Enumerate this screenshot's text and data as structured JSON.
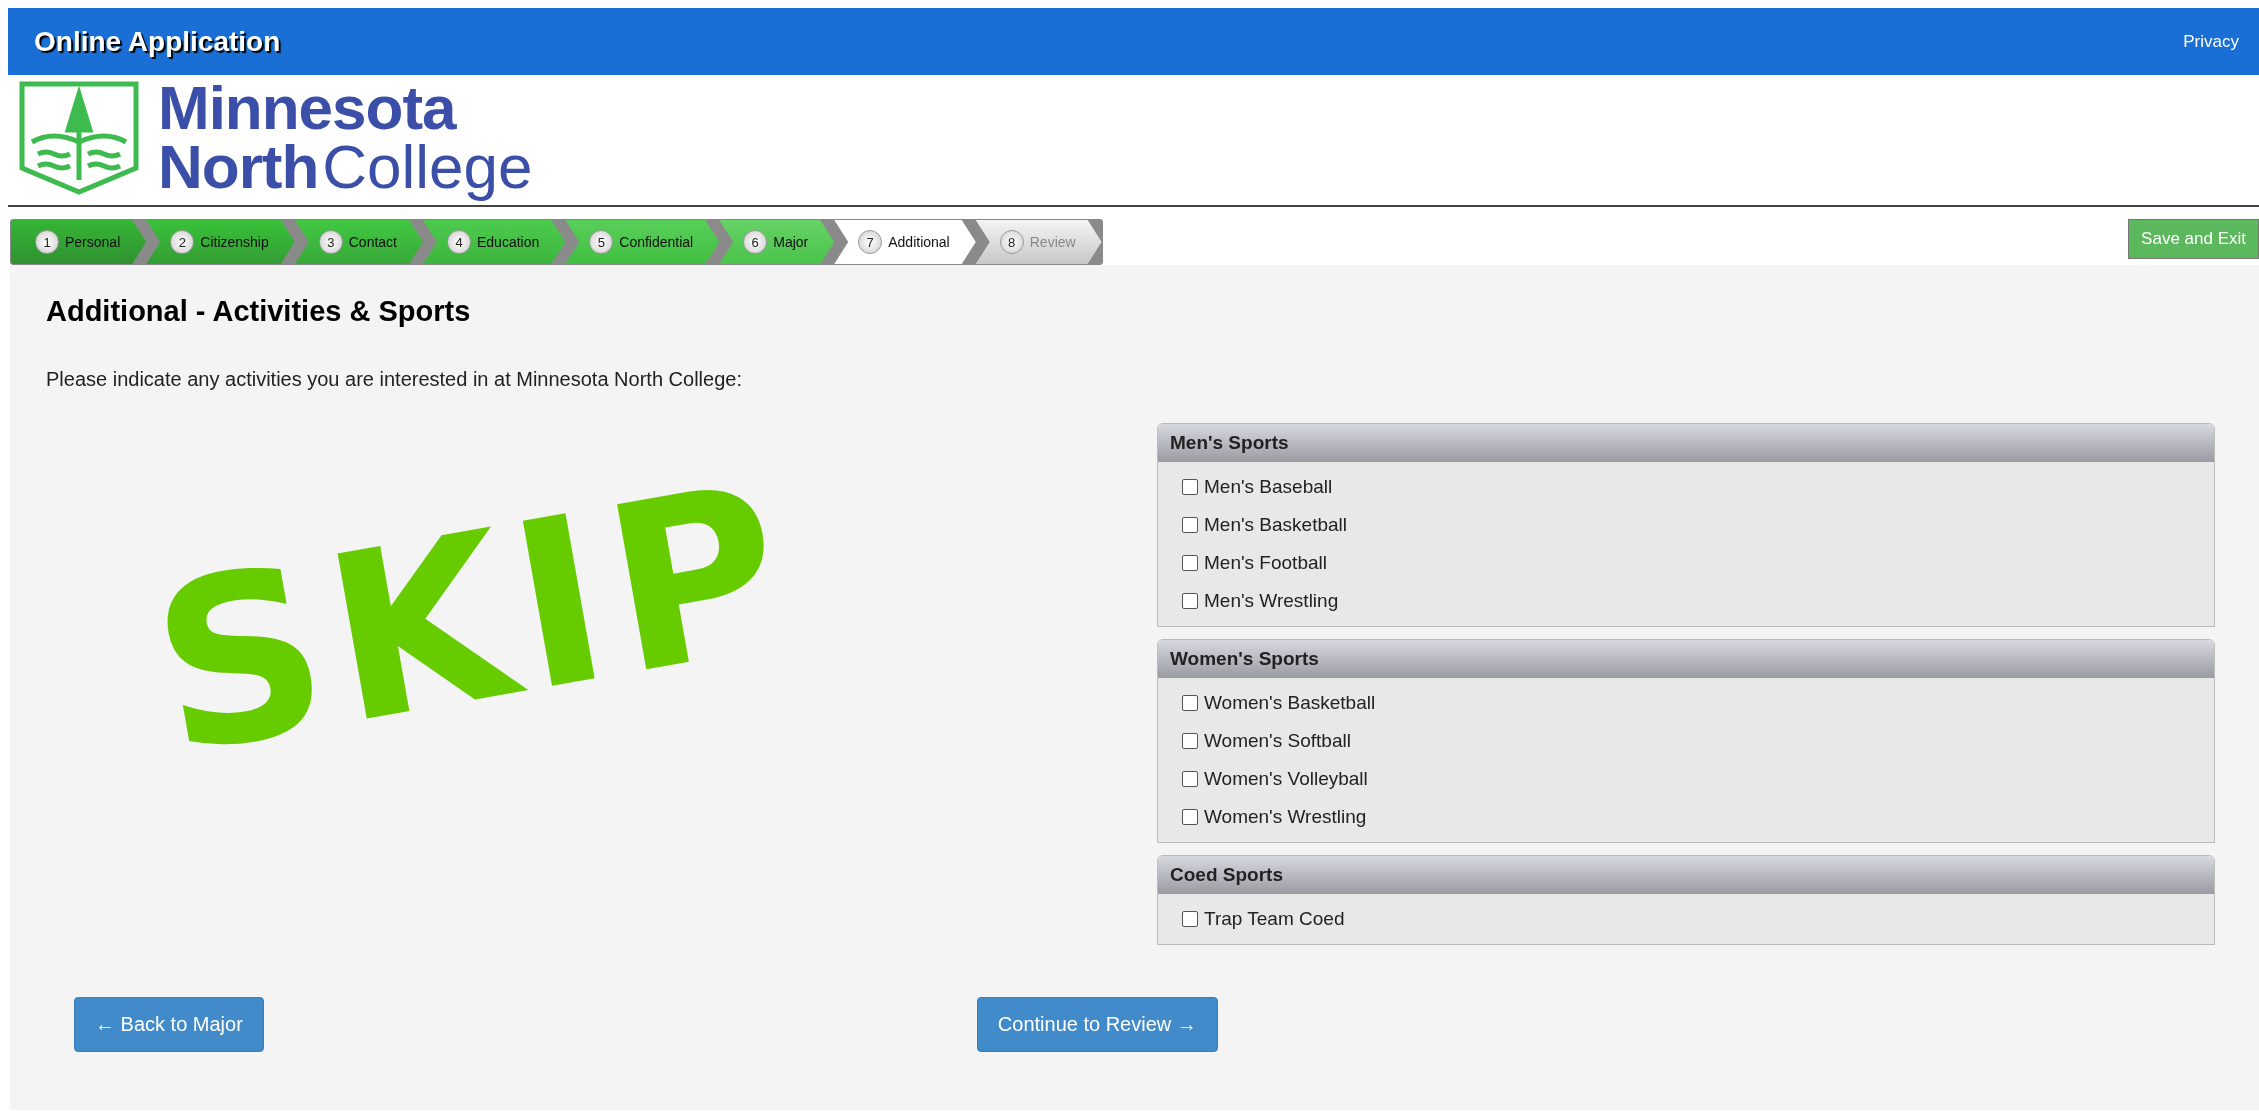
{
  "header": {
    "title": "Online Application",
    "privacy_link": "Privacy"
  },
  "logo": {
    "line1": "Minnesota",
    "line2_bold": "North",
    "line2_light": "College"
  },
  "steps": [
    {
      "number": "1",
      "label": "Personal",
      "completed": true,
      "selected": false
    },
    {
      "number": "2",
      "label": "Citizenship",
      "completed": true,
      "selected": false
    },
    {
      "number": "3",
      "label": "Contact",
      "completed": true,
      "selected": false
    },
    {
      "number": "4",
      "label": "Education",
      "completed": true,
      "selected": false
    },
    {
      "number": "5",
      "label": "Confidential",
      "completed": true,
      "selected": false
    },
    {
      "number": "6",
      "label": "Major",
      "completed": true,
      "selected": false
    },
    {
      "number": "7",
      "label": "Additional",
      "completed": false,
      "selected": true
    },
    {
      "number": "8",
      "label": "Review",
      "completed": false,
      "selected": false
    }
  ],
  "save_button": "Save and Exit",
  "heading": "Additional - Activities & Sports",
  "intro": "Please indicate any activities you are interested in at Minnesota North College:",
  "annotation": "SKIP",
  "groups": [
    {
      "title": "Men's Sports",
      "options": [
        {
          "label": "Men's Baseball",
          "checked": false
        },
        {
          "label": "Men's Basketball",
          "checked": false
        },
        {
          "label": "Men's Football",
          "checked": false
        },
        {
          "label": "Men's Wrestling",
          "checked": false
        }
      ]
    },
    {
      "title": "Women's Sports",
      "options": [
        {
          "label": "Women's Basketball",
          "checked": false
        },
        {
          "label": "Women's Softball",
          "checked": false
        },
        {
          "label": "Women's Volleyball",
          "checked": false
        },
        {
          "label": "Women's Wrestling",
          "checked": false
        }
      ]
    },
    {
      "title": "Coed Sports",
      "options": [
        {
          "label": "Trap Team Coed",
          "checked": false
        }
      ]
    }
  ],
  "back_button": "← Back to Major",
  "continue_button": "Continue to Review →"
}
